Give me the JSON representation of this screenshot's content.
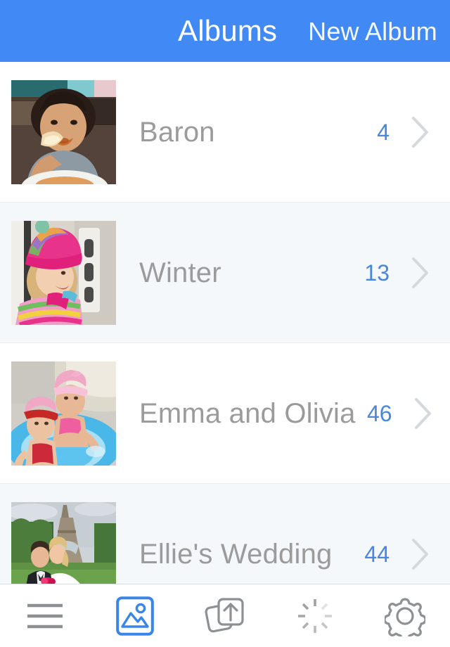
{
  "header": {
    "title": "Albums",
    "action_label": "New Album"
  },
  "colors": {
    "header_background": "#4189f5",
    "header_text": "#ffffff",
    "row_background": "#ffffff",
    "row_background_alt": "#f4f8fb",
    "album_name": "#9b9b9b",
    "count_accent": "#4a86dd",
    "chevron": "#d5d9dc",
    "toolbar_icon": "#8d9194",
    "toolbar_icon_active": "#3a86e8"
  },
  "albums": [
    {
      "name": "Baron",
      "count": "4",
      "thumbnail": "photo-child-eating",
      "chevron_icon": "chevron-right-icon"
    },
    {
      "name": "Winter",
      "count": "13",
      "thumbnail": "photo-girl-winter-hat",
      "chevron_icon": "chevron-right-icon"
    },
    {
      "name": "Emma and Olivia",
      "count": "46",
      "thumbnail": "photo-two-girls-pool",
      "chevron_icon": "chevron-right-icon"
    },
    {
      "name": "Ellie's Wedding",
      "count": "44",
      "thumbnail": "photo-wedding-eiffel-tower",
      "chevron_icon": "chevron-right-icon"
    }
  ],
  "toolbar": {
    "items": [
      {
        "icon": "hamburger-menu-icon",
        "label": "Menu",
        "active": false
      },
      {
        "icon": "photos-icon",
        "label": "Photos",
        "active": true
      },
      {
        "icon": "upload-icon",
        "label": "Upload",
        "active": false
      },
      {
        "icon": "activity-spinner-icon",
        "label": "Activity",
        "active": false
      },
      {
        "icon": "gear-icon",
        "label": "Settings",
        "active": false
      }
    ]
  }
}
